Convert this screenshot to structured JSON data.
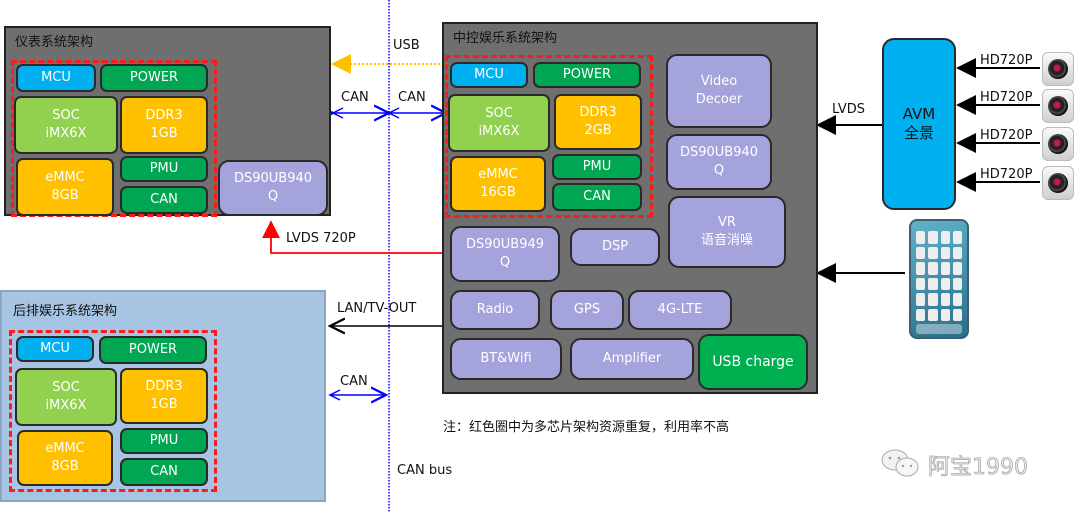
{
  "cluster": {
    "title": "仪表系统架构",
    "mcu": "MCU",
    "power": "POWER",
    "soc": "SOC\niMX6X",
    "ddr": "DDR3\n1GB",
    "emmc": "eMMC\n8GB",
    "pmu": "PMU",
    "can": "CAN",
    "deser": "DS90UB940\nQ"
  },
  "ivi": {
    "title": "中控娱乐系统架构",
    "mcu": "MCU",
    "power": "POWER",
    "soc": "SOC\niMX6X",
    "ddr": "DDR3\n2GB",
    "emmc": "eMMC\n16GB",
    "pmu": "PMU",
    "can": "CAN",
    "video_decoder": "Video\nDecoer",
    "deser": "DS90UB940\nQ",
    "vr": "VR\n语音消噪",
    "ser": "DS90UB949\nQ",
    "dsp": "DSP",
    "radio": "Radio",
    "gps": "GPS",
    "lte": "4G-LTE",
    "btwifi": "BT&Wifi",
    "amplifier": "Amplifier",
    "usb_charge": "USB charge"
  },
  "rear": {
    "title": "后排娱乐系统架构",
    "mcu": "MCU",
    "power": "POWER",
    "soc": "SOC\niMX6X",
    "ddr": "DDR3\n1GB",
    "emmc": "eMMC\n8GB",
    "pmu": "PMU",
    "can": "CAN"
  },
  "avm": {
    "label": "AVM\n全景",
    "cameras": [
      "HD720P",
      "HD720P",
      "HD720P",
      "HD720P"
    ]
  },
  "links": {
    "usb": "USB",
    "can_left": "CAN",
    "can_right": "CAN",
    "lvds_720p": "LVDS 720P",
    "lvds": "LVDS",
    "lan_tv_out": "LAN/TV-OUT",
    "can_rear": "CAN",
    "can_bus": "CAN bus"
  },
  "note": "注：红色圈中为多芯片架构资源重复，利用率不高",
  "watermark": "阿宝1990",
  "colors": {
    "mcu": "#00b0f0",
    "green": "#00a651",
    "soc": "#92d050",
    "memory": "#ffc000",
    "peripheral": "#a5a3dc",
    "dashed_highlight": "#ff1a1a",
    "can_arrow": "#0000ff",
    "usb_arrow": "#ffc000",
    "lvds_arrow": "#ff0000"
  }
}
